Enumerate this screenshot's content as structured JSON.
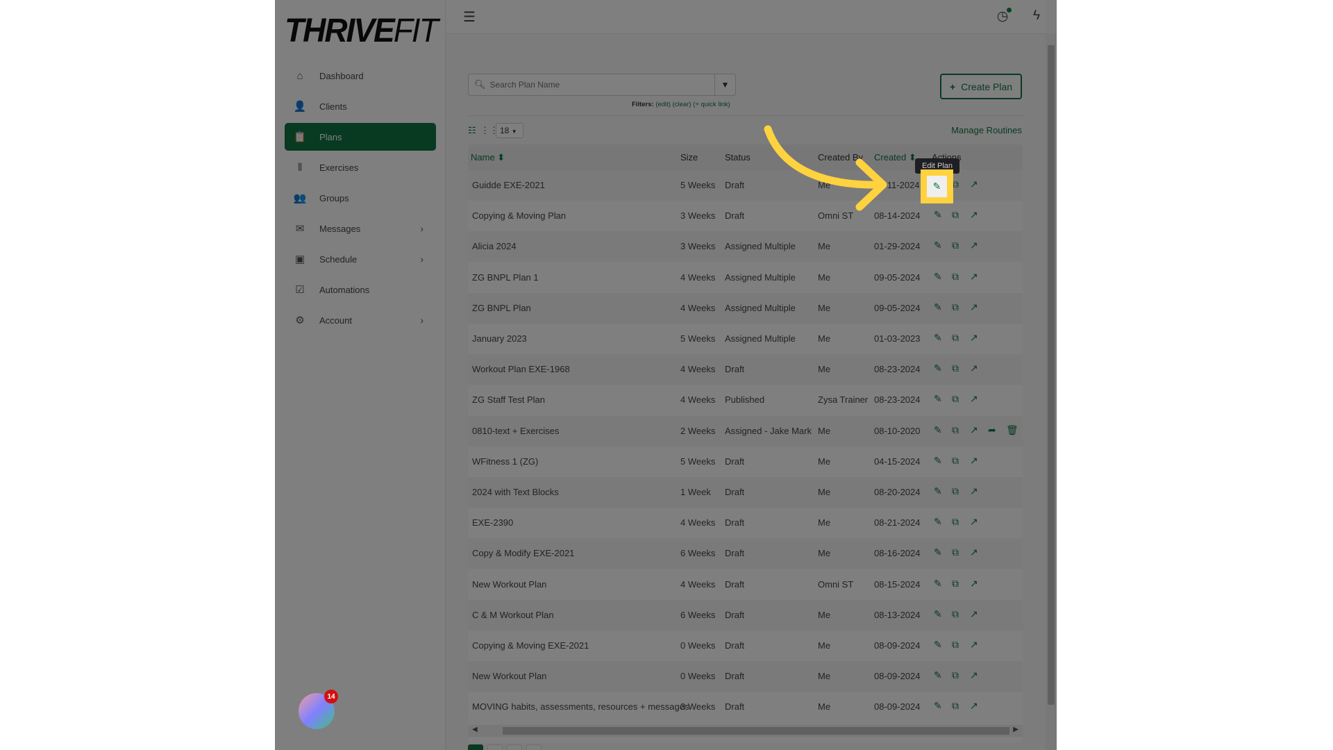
{
  "brand": {
    "logo_bold": "THRIVE",
    "logo_light": "FIT"
  },
  "sidebar": {
    "items": [
      {
        "label": "Dashboard",
        "icon": "home-icon",
        "glyph": "⌂"
      },
      {
        "label": "Clients",
        "icon": "user-icon",
        "glyph": "👤"
      },
      {
        "label": "Plans",
        "icon": "clipboard-icon",
        "glyph": "📋",
        "active": true
      },
      {
        "label": "Exercises",
        "icon": "dumbbell-icon",
        "glyph": "⫴"
      },
      {
        "label": "Groups",
        "icon": "users-icon",
        "glyph": "👥"
      },
      {
        "label": "Messages",
        "icon": "envelope-icon",
        "glyph": "✉",
        "chevron": true
      },
      {
        "label": "Schedule",
        "icon": "calendar-icon",
        "glyph": "▣",
        "chevron": true
      },
      {
        "label": "Automations",
        "icon": "checkbox-icon",
        "glyph": "☑"
      },
      {
        "label": "Account",
        "icon": "gear-icon",
        "glyph": "⚙",
        "chevron": true
      }
    ]
  },
  "topbar": {
    "icons": [
      "clock-icon",
      "lightning-icon",
      "grid-icon",
      "bell-icon"
    ]
  },
  "search": {
    "placeholder": "Search Plan Name",
    "value": ""
  },
  "filters": {
    "label": "Filters:",
    "edit": "(edit)",
    "clear": "(clear)",
    "quick_link": "(+ quick link)"
  },
  "create_plan": {
    "label": "Create Plan",
    "icon": "plus-icon"
  },
  "per_page": "18",
  "manage_routines": "Manage Routines",
  "table": {
    "columns": [
      "Name",
      "Size",
      "Status",
      "Created By",
      "Created",
      "Actions"
    ],
    "rows": [
      [
        "Guidde EXE-2021",
        "5 Weeks",
        "Draft",
        "Me",
        "09-11-2024"
      ],
      [
        "Copying & Moving Plan",
        "3 Weeks",
        "Draft",
        "Omni ST",
        "08-14-2024"
      ],
      [
        "Alicia 2024",
        "3 Weeks",
        "Assigned Multiple",
        "Me",
        "01-29-2024"
      ],
      [
        "ZG BNPL Plan 1",
        "4 Weeks",
        "Assigned Multiple",
        "Me",
        "09-05-2024"
      ],
      [
        "ZG BNPL Plan",
        "4 Weeks",
        "Assigned Multiple",
        "Me",
        "09-05-2024"
      ],
      [
        "January 2023",
        "5 Weeks",
        "Assigned Multiple",
        "Me",
        "01-03-2023"
      ],
      [
        "Workout Plan EXE-1968",
        "4 Weeks",
        "Draft",
        "Me",
        "08-23-2024"
      ],
      [
        "ZG Staff Test Plan",
        "4 Weeks",
        "Published",
        "Zysa Trainer",
        "08-23-2024"
      ],
      [
        "0810-text + Exercises",
        "2 Weeks",
        "Assigned - Jake Mark",
        "Me",
        "08-10-2020"
      ],
      [
        "WFitness 1 (ZG)",
        "5 Weeks",
        "Draft",
        "Me",
        "04-15-2024"
      ],
      [
        "2024 with Text Blocks",
        "1 Week",
        "Draft",
        "Me",
        "08-20-2024"
      ],
      [
        "EXE-2390",
        "4 Weeks",
        "Draft",
        "Me",
        "08-21-2024"
      ],
      [
        "Copy & Modify EXE-2021",
        "6 Weeks",
        "Draft",
        "Me",
        "08-16-2024"
      ],
      [
        "New Workout Plan",
        "4 Weeks",
        "Draft",
        "Omni ST",
        "08-15-2024"
      ],
      [
        "C & M Workout Plan",
        "6 Weeks",
        "Draft",
        "Me",
        "08-13-2024"
      ],
      [
        "Copying & Moving EXE-2021",
        "0 Weeks",
        "Draft",
        "Me",
        "08-09-2024"
      ],
      [
        "New Workout Plan",
        "0 Weeks",
        "Draft",
        "Me",
        "08-09-2024"
      ],
      [
        "MOVING habits, assessments, resources + messages",
        "3 Weeks",
        "Draft",
        "Me",
        "08-09-2024"
      ]
    ],
    "extra_actions_row": 8
  },
  "tooltip": "Edit Plan",
  "chat_widget": {
    "badge": "14"
  },
  "colors": {
    "accent": "#107443",
    "highlight": "#ffd23f",
    "overlay": "rgba(0,0,0,0.5)"
  }
}
